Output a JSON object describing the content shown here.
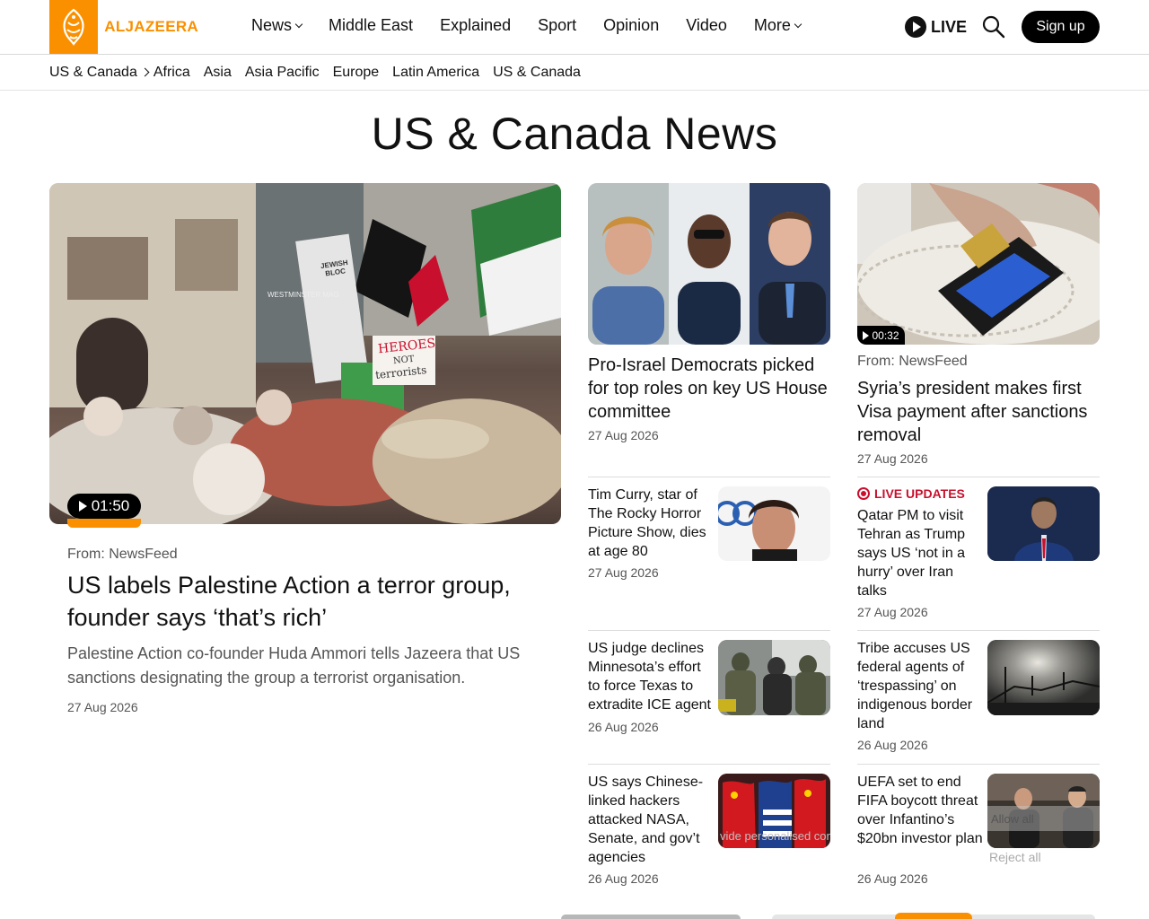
{
  "brand": {
    "name": "ALJAZEERA",
    "color": "#fa9000"
  },
  "nav": {
    "items": [
      {
        "label": "News",
        "dropdown": true
      },
      {
        "label": "Middle East",
        "dropdown": false
      },
      {
        "label": "Explained",
        "dropdown": false
      },
      {
        "label": "Sport",
        "dropdown": false
      },
      {
        "label": "Opinion",
        "dropdown": false
      },
      {
        "label": "Video",
        "dropdown": false
      },
      {
        "label": "More",
        "dropdown": true
      }
    ],
    "live_label": "LIVE",
    "signup_label": "Sign up"
  },
  "subnav": {
    "current": "US & Canada",
    "items": [
      "Africa",
      "Asia",
      "Asia Pacific",
      "Europe",
      "Latin America",
      "US & Canada"
    ]
  },
  "page": {
    "title": "US & Canada News"
  },
  "featured": {
    "duration": "01:50",
    "source": "From: NewsFeed",
    "headline": "US labels Palestine Action a terror group, founder says ‘that’s rich’",
    "summary": "Palestine Action co-founder Huda Ammori tells Jazeera that US sanctions designating the group a terrorist organisation.",
    "date": "27 Aug 2026",
    "image_text": {
      "sign1": "HEROES",
      "sign2": "NOT",
      "sign3": "terrorists",
      "banner": "JEWISH BLOC",
      "building": "WESTMINSTER MAG"
    }
  },
  "cards": {
    "c1": {
      "headline": "Pro-Israel Democrats picked for top roles on key US House committee",
      "date": "27 Aug 2026"
    },
    "c2": {
      "duration": "00:32",
      "source": "From: NewsFeed",
      "headline": "Syria’s president makes first Visa payment after sanctions removal",
      "date": "27 Aug 2026"
    }
  },
  "list": [
    {
      "headline": "Tim Curry, star of The Rocky Horror Picture Show, dies at age 80",
      "date": "27 Aug 2026"
    },
    {
      "live_tag": "LIVE UPDATES",
      "headline": "Qatar PM to visit Tehran as Trump says US ‘not in a hurry’ over Iran talks",
      "date": "27 Aug 2026"
    },
    {
      "headline": "US judge declines Minnesota’s effort to force Texas to extradite ICE agent",
      "date": "26 Aug 2026"
    },
    {
      "headline": "Tribe accuses US federal agents of ‘trespassing’ on indigenous border land",
      "date": "26 Aug 2026"
    },
    {
      "headline": "US says Chinese-linked hackers attacked NASA, Senate, and gov’t agencies",
      "date": "26 Aug 2026"
    },
    {
      "headline": "UEFA set to end FIFA boycott threat over Infantino’s $20bn investor plan",
      "date": "26 Aug 2026"
    }
  ],
  "consent": {
    "allow": "Allow all",
    "reject": "Reject all",
    "partial": "vide personalised con"
  }
}
